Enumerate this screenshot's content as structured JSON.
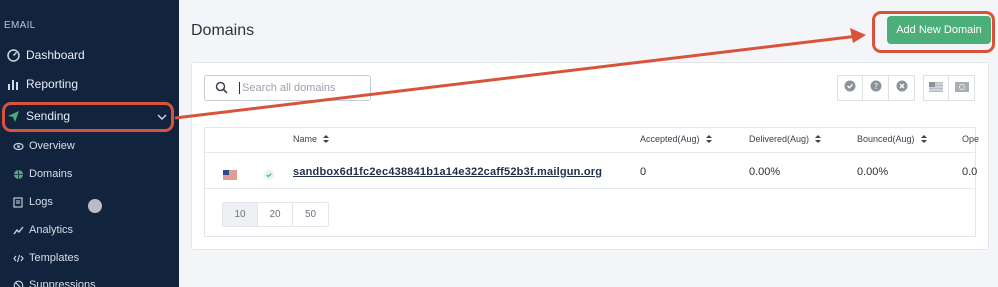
{
  "sidebar": {
    "section": "EMAIL",
    "items": [
      {
        "label": "Dashboard",
        "icon": "dashboard-icon"
      },
      {
        "label": "Reporting",
        "icon": "bar-chart-icon"
      },
      {
        "label": "Sending",
        "icon": "paper-plane-icon"
      }
    ],
    "sub_items": [
      {
        "label": "Overview",
        "icon": "eye-icon"
      },
      {
        "label": "Domains",
        "icon": "globe-icon"
      },
      {
        "label": "Logs",
        "icon": "document-icon"
      },
      {
        "label": "Analytics",
        "icon": "trend-icon"
      },
      {
        "label": "Templates",
        "icon": "code-icon"
      },
      {
        "label": "Suppressions",
        "icon": "ban-icon"
      }
    ]
  },
  "header": {
    "title": "Domains",
    "add_button": "Add New Domain"
  },
  "search": {
    "placeholder": "Search all domains",
    "value": ""
  },
  "filters": [
    "check-circle-icon",
    "question-circle-icon",
    "x-circle-icon",
    "us-flag-icon",
    "eu-flag-icon"
  ],
  "table": {
    "columns": [
      "Name",
      "Accepted(Aug)",
      "Delivered(Aug)",
      "Bounced(Aug)",
      "Ope"
    ],
    "rows": [
      {
        "region": "us-flag-icon",
        "status": "verified-icon",
        "name": "sandbox6d1fc2ec438841b1a14e322caff52b3f.mailgun.org",
        "accepted": "0",
        "delivered": "0.00%",
        "bounced": "0.00%",
        "opened": "0.0"
      }
    ]
  },
  "pagination": {
    "options": [
      "10",
      "20",
      "50"
    ],
    "selected": "10"
  },
  "colors": {
    "sidebar_bg": "#12243d",
    "accent_green": "#4caf7a",
    "annotation_red": "#d9533b"
  }
}
